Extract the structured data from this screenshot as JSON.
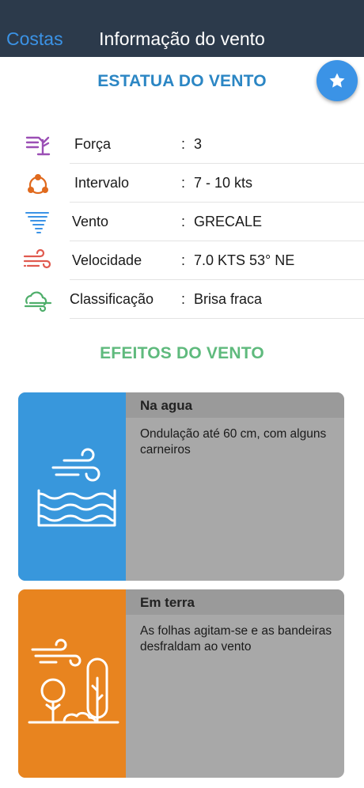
{
  "nav": {
    "back_label": "Costas",
    "title": "Informação do vento"
  },
  "status": {
    "title": "ESTATUA DO VENTO",
    "rows": [
      {
        "label": "Força",
        "value": "3",
        "icon": "beaufort-tree-icon"
      },
      {
        "label": "Intervalo",
        "value": "7 - 10  kts",
        "icon": "range-nodes-icon"
      },
      {
        "label": "Vento",
        "value": "GRECALE",
        "icon": "tornado-icon"
      },
      {
        "label": "Velocidade",
        "value": "7.0 KTS 53° NE",
        "icon": "wind-speed-icon"
      },
      {
        "label": "Classificação",
        "value": "Brisa fraca",
        "icon": "cloud-wind-icon"
      }
    ],
    "colon": ":"
  },
  "effects": {
    "title": "EFEITOS DO VENTO",
    "cards": [
      {
        "heading": "Na agua",
        "text": "Ondulação até 60 cm, com alguns carneiros",
        "color": "#3897dc",
        "icon": "wind-over-waves-icon"
      },
      {
        "heading": "Em terra",
        "text": "As folhas agitam-se e as bandeiras desfraldam ao vento",
        "color": "#e8841f",
        "icon": "wind-trees-icon"
      }
    ]
  },
  "colors": {
    "navbar": "#2c3a4b",
    "accent_blue": "#3b93e6",
    "status_title": "#2b86c4",
    "effects_title": "#5fba7d"
  }
}
